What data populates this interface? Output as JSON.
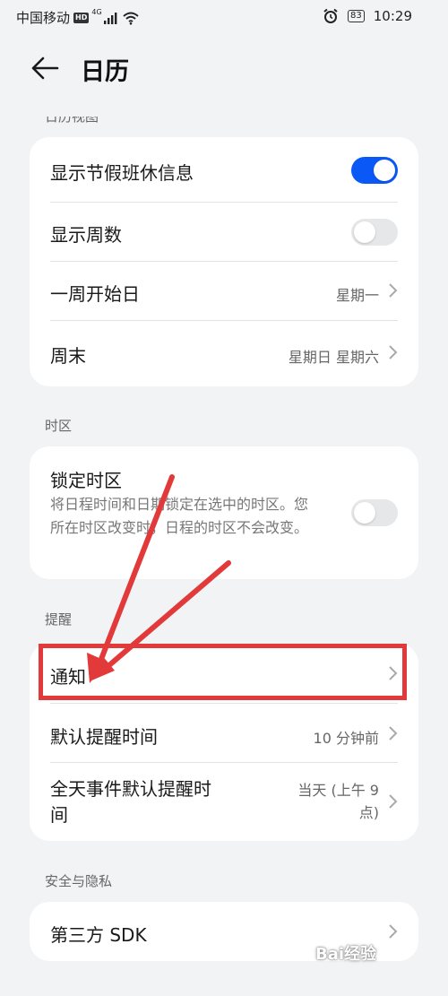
{
  "status_bar": {
    "carrier": "中国移动",
    "hd": "HD",
    "network": "4G",
    "battery": "83",
    "time": "10:29"
  },
  "header": {
    "title": "日历"
  },
  "sections": {
    "calendar_view": {
      "label": "日历视图",
      "items": {
        "holiday": "显示节假班休信息",
        "week_numbers": "显示周数",
        "week_start": "一周开始日",
        "week_start_value": "星期一",
        "weekend": "周末",
        "weekend_value": "星期日 星期六"
      }
    },
    "timezone": {
      "label": "时区",
      "lock_title": "锁定时区",
      "lock_desc": "将日程时间和日期锁定在选中的时区。您所在时区改变时，日程的时区不会改变。"
    },
    "reminder": {
      "label": "提醒",
      "notification": "通知",
      "default_time": "默认提醒时间",
      "default_time_value": "10 分钟前",
      "allday_line1": "全天事件默认提醒时",
      "allday_line2": "间",
      "allday_value_line1": "当天 (上午 9",
      "allday_value_line2": "点)"
    },
    "privacy": {
      "label": "安全与隐私",
      "sdk": "第三方 SDK"
    }
  },
  "toggles": {
    "holiday": true,
    "week_numbers": false,
    "lock_timezone": false
  },
  "colors": {
    "accent": "#0a59f7",
    "annotation": "#e23a3a",
    "background": "#f1f3f5"
  },
  "watermark": "Bai经验"
}
